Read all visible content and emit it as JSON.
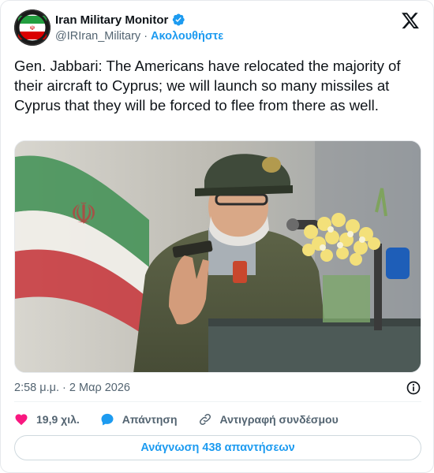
{
  "account": {
    "display_name": "Iran Military Monitor",
    "handle": "@IRIran_Military",
    "follow_label": "Ακολουθήστε",
    "avatar_icon": "iran-flag-avatar",
    "verified_icon": "verified-badge-icon",
    "verified_color": "#1d9bf0"
  },
  "tweet": {
    "text": "Gen. Jabbari: The Americans have relocated the majority of their aircraft to Cyprus; we will launch so many missiles at Cyprus that they will be forced to flee from there as well.",
    "timestamp": "2:58 μ.μ. · 2 Μαρ 2026"
  },
  "actions": {
    "likes_count": "19,9 χιλ.",
    "reply_label": "Απάντηση",
    "copy_link_label": "Αντιγραφή συνδέσμου",
    "like_color": "#f91880",
    "reply_color": "#1d9bf0"
  },
  "footer": {
    "read_replies_label": "Ανάγνωση 438 απαντήσεων"
  },
  "colors": {
    "accent": "#1d9bf0",
    "text_primary": "#0f1419",
    "text_secondary": "#536471"
  }
}
